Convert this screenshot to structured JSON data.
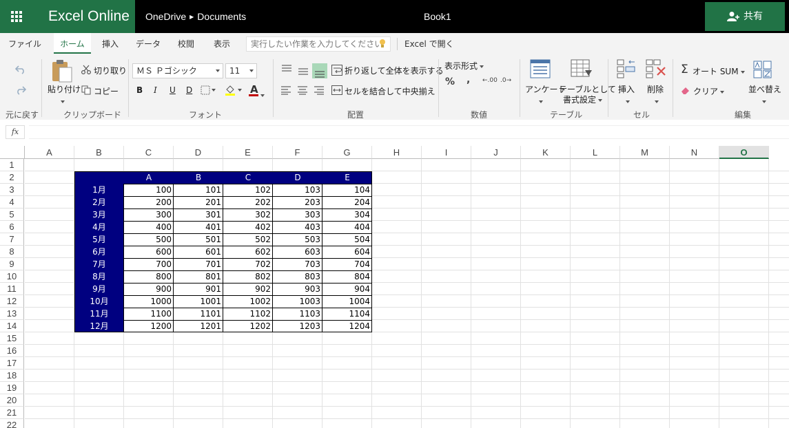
{
  "app": {
    "name": "Excel Online",
    "breadcrumb": [
      "OneDrive",
      "Documents"
    ],
    "doc_title": "Book1",
    "share_label": "共有"
  },
  "menu": {
    "tabs": [
      "ファイル",
      "ホーム",
      "挿入",
      "データ",
      "校閲",
      "表示"
    ],
    "active_tab": "ホーム",
    "tell_me_placeholder": "実行したい作業を入力してください",
    "open_in_excel": "Excel で開く"
  },
  "ribbon": {
    "undo_group": "元に戻す",
    "clipboard": {
      "label": "クリップボード",
      "paste": "貼り付け",
      "cut": "切り取り",
      "copy": "コピー"
    },
    "font": {
      "label": "フォント",
      "name": "ＭＳ Ｐゴシック",
      "size": "11",
      "bold": "B",
      "italic": "I",
      "underline": "U",
      "double_underline": "D",
      "font_color": "A"
    },
    "alignment": {
      "label": "配置",
      "wrap": "折り返して全体を表示する",
      "merge": "セルを結合して中央揃え"
    },
    "number": {
      "label": "数値",
      "format": "表示形式",
      "percent": "%",
      "comma": ",",
      "inc": ".00",
      "dec": ".0"
    },
    "tables": {
      "label": "テーブル",
      "survey": "アンケート",
      "format_as_table_1": "テーブルとして",
      "format_as_table_2": "書式設定"
    },
    "cells": {
      "label": "セル",
      "insert": "挿入",
      "delete": "削除"
    },
    "editing": {
      "label": "編集",
      "autosum": "オート SUM",
      "clear": "クリア",
      "sort": "並べ替え"
    }
  },
  "formula_bar": {
    "fx": "fx",
    "value": ""
  },
  "sheet": {
    "columns": [
      "A",
      "B",
      "C",
      "D",
      "E",
      "F",
      "G",
      "H",
      "I",
      "J",
      "K",
      "L",
      "M",
      "N",
      "O"
    ],
    "selected_column": "O",
    "rows": [
      "1",
      "2",
      "3",
      "4",
      "5",
      "6",
      "7",
      "8",
      "9",
      "10",
      "11",
      "12",
      "13",
      "14",
      "15",
      "16",
      "17",
      "18",
      "19",
      "20",
      "21",
      "22"
    ],
    "table": {
      "header": [
        "",
        "A",
        "B",
        "C",
        "D",
        "E"
      ],
      "accent_color": "#000080",
      "rows": [
        [
          "1月",
          "100",
          "101",
          "102",
          "103",
          "104"
        ],
        [
          "2月",
          "200",
          "201",
          "202",
          "203",
          "204"
        ],
        [
          "3月",
          "300",
          "301",
          "302",
          "303",
          "304"
        ],
        [
          "4月",
          "400",
          "401",
          "402",
          "403",
          "404"
        ],
        [
          "5月",
          "500",
          "501",
          "502",
          "503",
          "504"
        ],
        [
          "6月",
          "600",
          "601",
          "602",
          "603",
          "604"
        ],
        [
          "7月",
          "700",
          "701",
          "702",
          "703",
          "704"
        ],
        [
          "8月",
          "800",
          "801",
          "802",
          "803",
          "804"
        ],
        [
          "9月",
          "900",
          "901",
          "902",
          "903",
          "904"
        ],
        [
          "10月",
          "1000",
          "1001",
          "1002",
          "1003",
          "1004"
        ],
        [
          "11月",
          "1100",
          "1101",
          "1102",
          "1103",
          "1104"
        ],
        [
          "12月",
          "1200",
          "1201",
          "1202",
          "1203",
          "1204"
        ]
      ]
    }
  }
}
